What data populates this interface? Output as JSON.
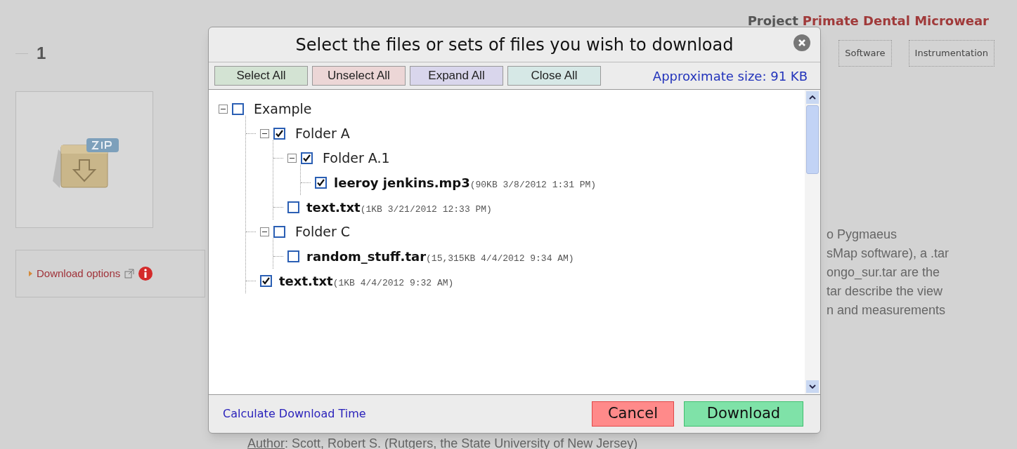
{
  "page": {
    "section_number": "1",
    "project_label": "Project",
    "project_name": "Primate Dental Microwear",
    "tabs": [
      {
        "label": "Software",
        "selected": false
      },
      {
        "label": "Instrumentation",
        "selected": false
      }
    ],
    "download_options": "Download options",
    "description_lines": [
      "o Pygmaeus",
      "sMap software), a .tar",
      "ongo_sur.tar are the",
      "tar describe the view",
      "n and measurements"
    ],
    "author_label": "Author",
    "author_value": ": Scott, Robert S. (Rutgers, the State University of New Jersey)"
  },
  "dialog": {
    "title": "Select the files or sets of files you wish to download",
    "toolbar": [
      {
        "label": "Select All",
        "color": "#d3e3d3"
      },
      {
        "label": "Unselect All",
        "color": "#ecd6d6"
      },
      {
        "label": "Expand All",
        "color": "#d9d6ec"
      },
      {
        "label": "Close All",
        "color": "#d6e8e6"
      }
    ],
    "size_text": "Approximate size: 91 KB",
    "tree": [
      {
        "kind": "folder",
        "label": "Example",
        "checked": false,
        "expanded": true,
        "children": [
          {
            "kind": "folder",
            "label": "Folder A",
            "checked": true,
            "expanded": true,
            "children": [
              {
                "kind": "folder",
                "label": "Folder A.1",
                "checked": true,
                "expanded": true,
                "children": [
                  {
                    "kind": "file",
                    "label": "leeroy jenkins.mp3",
                    "meta": "(90KB 3/8/2012 1:31 PM)",
                    "checked": true
                  }
                ]
              },
              {
                "kind": "file",
                "label": "text.txt",
                "meta": "(1KB 3/21/2012 12:33 PM)",
                "checked": false
              }
            ]
          },
          {
            "kind": "folder",
            "label": "Folder C",
            "checked": false,
            "expanded": true,
            "children": [
              {
                "kind": "file",
                "label": "random_stuff.tar",
                "meta": "(15,315KB 4/4/2012 9:34 AM)",
                "checked": false
              }
            ]
          },
          {
            "kind": "file",
            "label": "text.txt",
            "meta": "(1KB 4/4/2012 9:32 AM)",
            "checked": true
          }
        ]
      }
    ],
    "calc_link": "Calculate Download Time",
    "cancel": "Cancel",
    "download": "Download"
  }
}
